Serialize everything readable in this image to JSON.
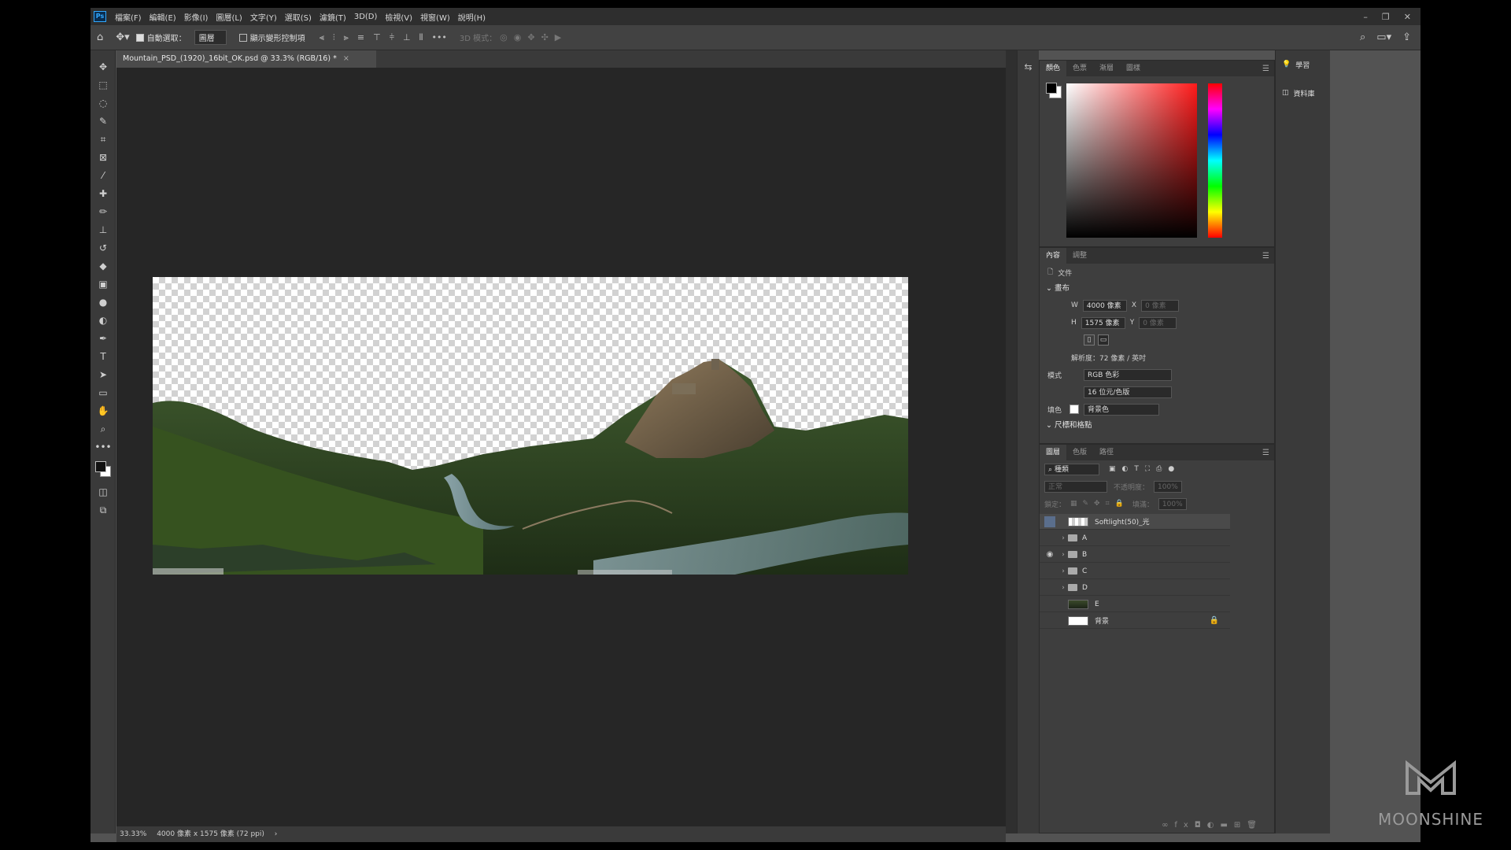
{
  "app": {
    "logo": "Ps"
  },
  "menubar": {
    "items": [
      "檔案(F)",
      "編輯(E)",
      "影像(I)",
      "圖層(L)",
      "文字(Y)",
      "選取(S)",
      "濾鏡(T)",
      "3D(D)",
      "檢視(V)",
      "視窗(W)",
      "說明(H)"
    ]
  },
  "window_controls": {
    "minimize": "–",
    "restore": "❐",
    "close": "✕"
  },
  "options_bar": {
    "auto_select_label": "自動選取：",
    "auto_select_value": "圖層",
    "show_transform_label": "顯示變形控制項",
    "mode_3d_label": "3D 模式："
  },
  "document": {
    "tab_title": "Mountain_PSD_(1920)_16bit_OK.psd @ 33.3% (RGB/16) *",
    "close": "×"
  },
  "status_bar": {
    "zoom": "33.33%",
    "info": "4000 像素 x 1575 像素 (72 ppi)",
    "arrow": "›"
  },
  "color_panel": {
    "tabs": [
      "顏色",
      "色票",
      "漸層",
      "圖樣"
    ],
    "foreground": "#000000",
    "background": "#ffffff"
  },
  "properties_panel": {
    "tabs": [
      "內容",
      "調整"
    ],
    "doc_label": "文件",
    "canvas_section": "畫布",
    "w_label": "W",
    "w_value": "4000 像素",
    "x_label": "X",
    "x_value": "0 像素",
    "h_label": "H",
    "h_value": "1575 像素",
    "y_label": "Y",
    "y_value": "0 像素",
    "resolution": "解析度：72 像素 / 英吋",
    "mode_label": "模式",
    "mode_value": "RGB 色彩",
    "depth_value": "16 位元/色版",
    "fill_label": "填色",
    "fill_value": "背景色",
    "rulers_section": "尺標和格點"
  },
  "layers_panel": {
    "tabs": [
      "圖層",
      "色版",
      "路徑"
    ],
    "filter_kind": "種類",
    "blend_mode": "正常",
    "opacity_label": "不透明度：",
    "opacity_value": "100%",
    "lock_label": "鎖定：",
    "fill_label": "填滿：",
    "fill_value": "100%",
    "layers": [
      {
        "name": "Softlight(50)_光",
        "type": "layer",
        "visible": false,
        "selected": true
      },
      {
        "name": "A",
        "type": "group",
        "visible": false,
        "selected": false
      },
      {
        "name": "B",
        "type": "group",
        "visible": true,
        "selected": false
      },
      {
        "name": "C",
        "type": "group",
        "visible": false,
        "selected": false
      },
      {
        "name": "D",
        "type": "group",
        "visible": false,
        "selected": false
      },
      {
        "name": "E",
        "type": "layer",
        "visible": false,
        "selected": false
      },
      {
        "name": "背景",
        "type": "background",
        "visible": false,
        "selected": false,
        "locked": true
      }
    ]
  },
  "right_column": {
    "items": [
      {
        "icon": "lightbulb-icon",
        "label": "學習"
      },
      {
        "icon": "library-icon",
        "label": "資料庫"
      }
    ]
  },
  "watermark": {
    "text": "MOONSHINE"
  }
}
